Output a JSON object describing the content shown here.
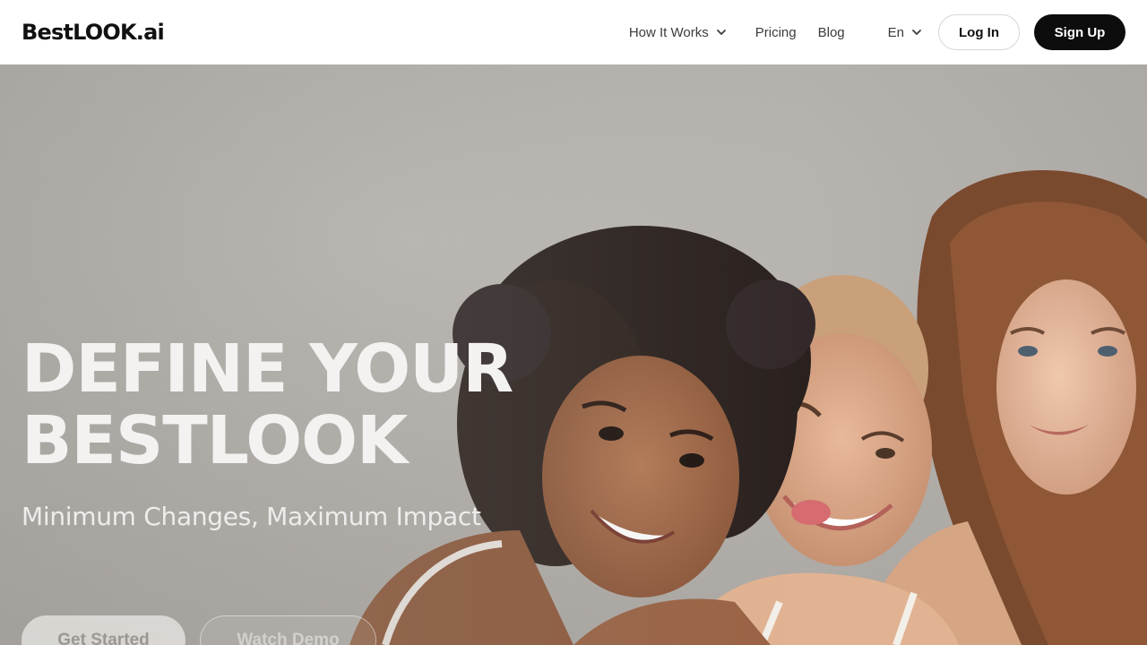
{
  "brand": {
    "name": "BestLOOK.ai"
  },
  "nav": {
    "how_it_works": "How It Works",
    "pricing": "Pricing",
    "blog": "Blog",
    "language": "En",
    "login": "Log In",
    "signup": "Sign Up"
  },
  "hero": {
    "title_line1": "DEFINE YOUR",
    "title_line2": "BESTLOOK",
    "subtitle": "Minimum Changes, Maximum Impact",
    "cta_primary": "Get Started",
    "cta_secondary": "Watch Demo"
  },
  "icons": {
    "chevron": "chevron-down-icon"
  },
  "colors": {
    "header_bg": "#ffffff",
    "signup_bg": "#0d0d0d",
    "hero_bg": "#b5b1ad",
    "hero_text": "#f4f2f1"
  }
}
